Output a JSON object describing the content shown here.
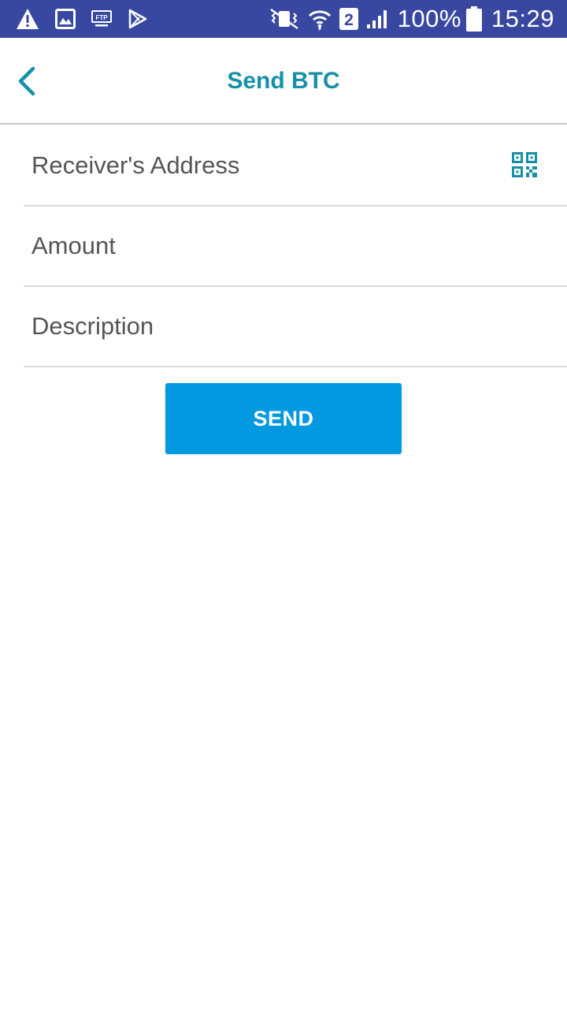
{
  "status_bar": {
    "battery_text": "100%",
    "time": "15:29",
    "sim_slot": "2",
    "ftp_label": "FTP",
    "background": "#3848a0",
    "icons_left": [
      "warning-icon",
      "image-icon",
      "ftp-icon",
      "play-store-icon"
    ],
    "icons_right": [
      "vibrate-icon",
      "wifi-icon",
      "sim-icon",
      "signal-icon",
      "battery-icon"
    ]
  },
  "header": {
    "title": "Send BTC",
    "back_icon": "chevron-left-icon",
    "accent_color": "#1590a8"
  },
  "form": {
    "receiver_placeholder": "Receiver's Address",
    "amount_placeholder": "Amount",
    "description_placeholder": "Description",
    "qr_icon": "qr-code-icon"
  },
  "send_button": {
    "label": "SEND",
    "color": "#0299e0"
  }
}
